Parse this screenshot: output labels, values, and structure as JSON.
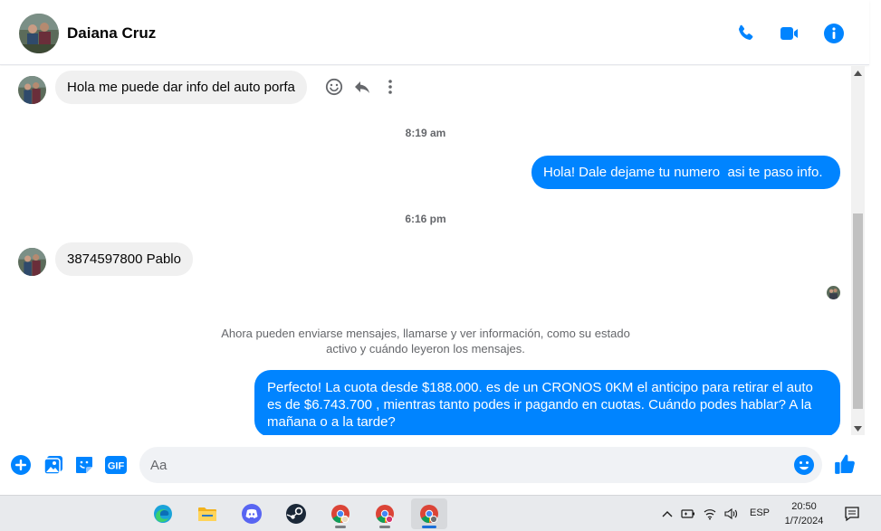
{
  "header": {
    "contact_name": "Daiana Cruz",
    "actions": [
      "phone-icon",
      "video-call-icon",
      "info-icon"
    ],
    "accent_color": "#0084ff"
  },
  "messages": [
    {
      "direction": "incoming",
      "text": "Hola me puede dar info del auto porfa"
    },
    {
      "type": "timestamp",
      "text": "8:19 am"
    },
    {
      "direction": "outgoing",
      "text": "Hola! Dale dejame tu numero  asi te paso info."
    },
    {
      "type": "timestamp",
      "text": "6:16 pm"
    },
    {
      "direction": "incoming",
      "text": "3874597800 Pablo"
    },
    {
      "type": "notice",
      "lines": [
        "Ahora pueden enviarse mensajes, llamarse y ver información, como su estado",
        "activo y cuándo leyeron los mensajes."
      ]
    },
    {
      "direction": "outgoing",
      "lines": [
        "Perfecto! La cuota desde $188.000. es de un CRONOS 0KM el anticipo para retirar el auto",
        "es de $6.743.700 , mientras tanto podes ir pagando en cuotas. Cuándo podes hablar? A la",
        "mañana o a la tarde?"
      ]
    }
  ],
  "composer": {
    "placeholder": "Aa",
    "value": "",
    "gif_label": "GIF",
    "buttons": [
      "plus-icon",
      "image-icon",
      "sticker-icon",
      "gif-icon",
      "emoji-icon",
      "thumbs-up-icon"
    ]
  },
  "taskbar": {
    "apps": [
      "edge-icon",
      "file-explorer-icon",
      "discord-icon",
      "steam-icon",
      "chrome-icon",
      "chrome-icon",
      "chrome-icon"
    ],
    "language": "ESP",
    "time": "20:50",
    "date": "1/7/2024"
  }
}
